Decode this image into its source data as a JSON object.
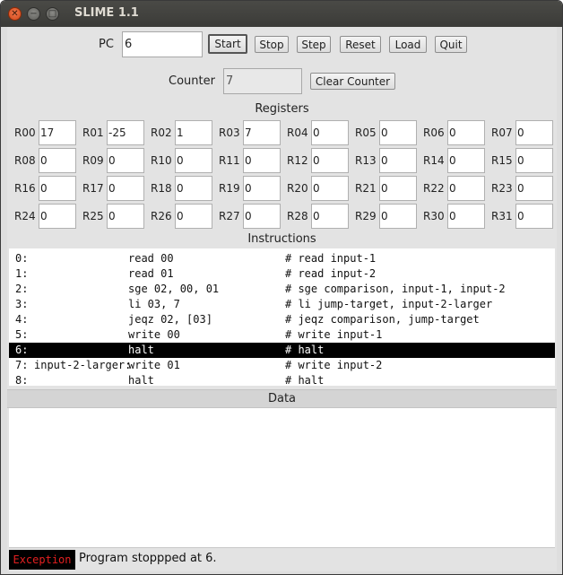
{
  "window": {
    "title": "SLIME 1.1"
  },
  "pc": {
    "label": "PC",
    "value": "6"
  },
  "buttons": {
    "start": "Start",
    "stop": "Stop",
    "step": "Step",
    "reset": "Reset",
    "load": "Load",
    "quit": "Quit",
    "clear_counter": "Clear Counter"
  },
  "counter": {
    "label": "Counter",
    "value": "7"
  },
  "registers_title": "Registers",
  "registers": [
    {
      "label": "R00",
      "value": "17"
    },
    {
      "label": "R01",
      "value": "-25"
    },
    {
      "label": "R02",
      "value": "1"
    },
    {
      "label": "R03",
      "value": "7"
    },
    {
      "label": "R04",
      "value": "0"
    },
    {
      "label": "R05",
      "value": "0"
    },
    {
      "label": "R06",
      "value": "0"
    },
    {
      "label": "R07",
      "value": "0"
    },
    {
      "label": "R08",
      "value": "0"
    },
    {
      "label": "R09",
      "value": "0"
    },
    {
      "label": "R10",
      "value": "0"
    },
    {
      "label": "R11",
      "value": "0"
    },
    {
      "label": "R12",
      "value": "0"
    },
    {
      "label": "R13",
      "value": "0"
    },
    {
      "label": "R14",
      "value": "0"
    },
    {
      "label": "R15",
      "value": "0"
    },
    {
      "label": "R16",
      "value": "0"
    },
    {
      "label": "R17",
      "value": "0"
    },
    {
      "label": "R18",
      "value": "0"
    },
    {
      "label": "R19",
      "value": "0"
    },
    {
      "label": "R20",
      "value": "0"
    },
    {
      "label": "R21",
      "value": "0"
    },
    {
      "label": "R22",
      "value": "0"
    },
    {
      "label": "R23",
      "value": "0"
    },
    {
      "label": "R24",
      "value": "0"
    },
    {
      "label": "R25",
      "value": "0"
    },
    {
      "label": "R26",
      "value": "0"
    },
    {
      "label": "R27",
      "value": "0"
    },
    {
      "label": "R28",
      "value": "0"
    },
    {
      "label": "R29",
      "value": "0"
    },
    {
      "label": "R30",
      "value": "0"
    },
    {
      "label": "R31",
      "value": "0"
    }
  ],
  "instructions_title": "Instructions",
  "instructions": [
    {
      "addr": "0:",
      "label": "",
      "code": "read 00",
      "comment": "# read input-1",
      "selected": false
    },
    {
      "addr": "1:",
      "label": "",
      "code": "read 01",
      "comment": "# read input-2",
      "selected": false
    },
    {
      "addr": "2:",
      "label": "",
      "code": "sge 02, 00, 01",
      "comment": "# sge comparison, input-1, input-2",
      "selected": false
    },
    {
      "addr": "3:",
      "label": "",
      "code": "li 03, 7",
      "comment": "# li jump-target, input-2-larger",
      "selected": false
    },
    {
      "addr": "4:",
      "label": "",
      "code": "jeqz 02, [03]",
      "comment": "# jeqz comparison, jump-target",
      "selected": false
    },
    {
      "addr": "5:",
      "label": "",
      "code": "write 00",
      "comment": "# write input-1",
      "selected": false
    },
    {
      "addr": "6:",
      "label": "",
      "code": "halt",
      "comment": "# halt",
      "selected": true
    },
    {
      "addr": "7:",
      "label": "input-2-larger:",
      "code": "write 01",
      "comment": "# write input-2",
      "selected": false
    },
    {
      "addr": "8:",
      "label": "",
      "code": "halt",
      "comment": "# halt",
      "selected": false
    }
  ],
  "data_title": "Data",
  "status": {
    "type": "Exception",
    "message": "Program stoppped at 6."
  }
}
